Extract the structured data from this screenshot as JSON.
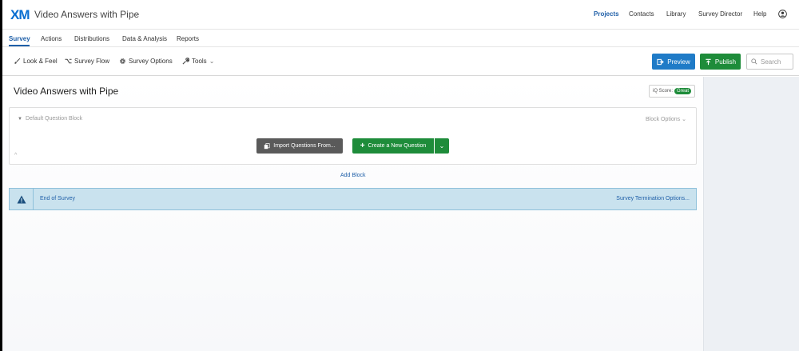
{
  "header": {
    "logo": "XM",
    "project_title": "Video Answers with Pipe",
    "nav": [
      "Projects",
      "Contacts",
      "Library",
      "Survey Director",
      "Help"
    ]
  },
  "tabs": [
    "Survey",
    "Actions",
    "Distributions",
    "Data & Analysis",
    "Reports"
  ],
  "toolbar": {
    "look_feel": "Look & Feel",
    "survey_flow": "Survey Flow",
    "survey_options": "Survey Options",
    "tools": "Tools",
    "preview": "Preview",
    "publish": "Publish",
    "search_placeholder": "Search"
  },
  "main": {
    "survey_title": "Video Answers with Pipe",
    "iq_score_label": "iQ Score:",
    "iq_score_value": "Great",
    "block_name": "Default Question Block",
    "block_options": "Block Options",
    "import_button": "Import Questions From...",
    "create_button": "Create a New Question",
    "add_block": "Add Block",
    "end_of_survey": "End of Survey",
    "termination_options": "Survey Termination Options..."
  },
  "colors": {
    "accent": "#1f5fa8",
    "preview": "#1f7bc7",
    "publish": "#1e8c3a",
    "end_survey_bg": "#c9e2ee"
  }
}
